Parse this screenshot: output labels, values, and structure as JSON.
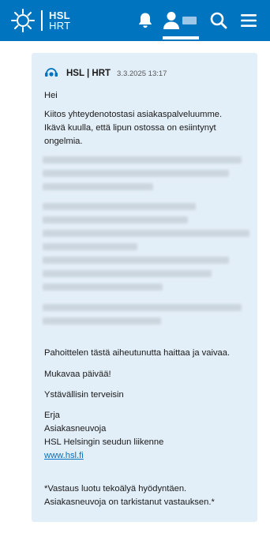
{
  "header": {
    "logo_line1": "HSL",
    "logo_line2": "HRT",
    "icons": [
      "hsl-logo-icon",
      "bell-icon",
      "user-icon",
      "search-icon",
      "menu-icon"
    ],
    "brand_color": "#0074bf"
  },
  "message": {
    "sender": "HSL | HRT",
    "timestamp": "3.3.2025 13:17",
    "greeting": "Hei",
    "intro_line1": "Kiitos yhteydenotostasi asiakaspalveluumme.",
    "intro_line2": "Ikävä kuulla, että lipun ostossa on esiintynyt",
    "intro_line3": "ongelmia.",
    "apology": "Pahoittelen tästä aiheutunutta haittaa ja vaivaa.",
    "wish": "Mukavaa päivää!",
    "closing": "Ystävällisin terveisin",
    "signature_name": "Erja",
    "signature_title": "Asiakasneuvoja",
    "signature_org": "HSL Helsingin seudun liikenne",
    "signature_link": "www.hsl.fi",
    "disclaimer_line1": "*Vastaus luotu tekoälyä hyödyntäen.",
    "disclaimer_line2": "Asiakasneuvoja on tarkistanut vastauksen.*",
    "card_color": "#e3eff8"
  }
}
